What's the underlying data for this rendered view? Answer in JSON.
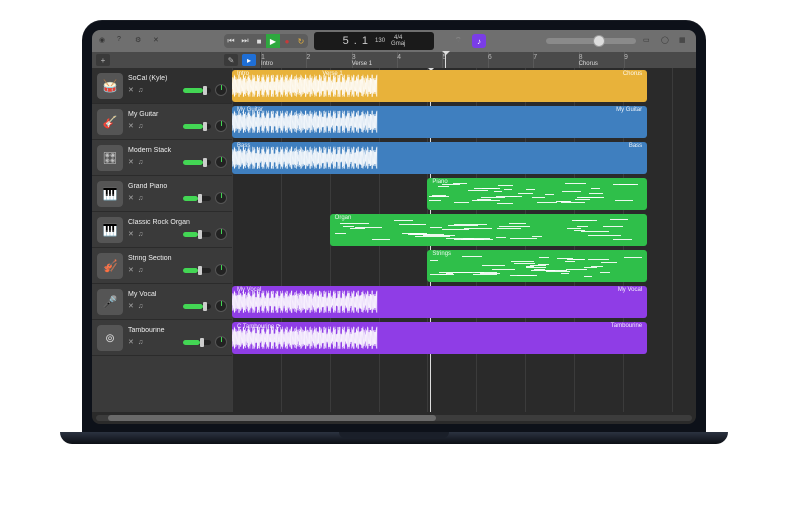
{
  "transport": {
    "position": "5 . 1",
    "tempo": "130",
    "time_sig": "4/4",
    "key": "Gmaj",
    "countin_icon": "countin-icon",
    "master_volume_pct": 58
  },
  "ruler": {
    "bars": [
      "1",
      "2",
      "3",
      "4",
      "5",
      "6",
      "7",
      "8",
      "9"
    ],
    "markers": [
      {
        "label": "Intro",
        "bar": 1
      },
      {
        "label": "Verse 1",
        "bar": 3
      },
      {
        "label": "Chorus",
        "bar": 8
      }
    ],
    "playhead_bar": 5.05,
    "visible_bars": 9.5
  },
  "tracks": [
    {
      "name": "SoCal (Kyle)",
      "type": "audio",
      "icon": "drums-icon",
      "color": "#e8b23a",
      "fader_pct": 70,
      "selected": true,
      "regions": [
        {
          "label_left": "Intro",
          "label_mid": "Verse 1",
          "label_right": "Chorus",
          "start": 1,
          "end": 9.5
        }
      ]
    },
    {
      "name": "My Guitar",
      "type": "audio",
      "icon": "guitar-icon",
      "color": "#3f7fbf",
      "fader_pct": 70,
      "regions": [
        {
          "label_left": "My Guitar",
          "label_right": "My Guitar",
          "start": 1,
          "end": 9.5
        }
      ]
    },
    {
      "name": "Modern Stack",
      "type": "audio",
      "icon": "synth-icon",
      "color": "#3f7fbf",
      "fader_pct": 70,
      "regions": [
        {
          "label_left": "Bass",
          "label_right": "Bass",
          "start": 1,
          "end": 9.5
        }
      ]
    },
    {
      "name": "Grand Piano",
      "type": "midi",
      "icon": "piano-icon",
      "color": "#2fbf4a",
      "fader_pct": 55,
      "regions": [
        {
          "label_left": "Piano",
          "start": 5,
          "end": 9.5
        }
      ]
    },
    {
      "name": "Classic Rock Organ",
      "type": "midi",
      "icon": "organ-icon",
      "color": "#2fbf4a",
      "fader_pct": 55,
      "regions": [
        {
          "label_left": "Organ",
          "start": 3,
          "end": 9.5
        }
      ]
    },
    {
      "name": "String Section",
      "type": "midi",
      "icon": "strings-icon",
      "color": "#2fbf4a",
      "fader_pct": 55,
      "regions": [
        {
          "label_left": "Strings",
          "start": 5,
          "end": 9.5
        }
      ]
    },
    {
      "name": "My Vocal",
      "type": "audio",
      "icon": "mic-icon",
      "color": "#8f3de6",
      "fader_pct": 70,
      "regions": [
        {
          "label_left": "My Vocal",
          "label_right": "My Vocal",
          "start": 1,
          "end": 9.5
        }
      ]
    },
    {
      "name": "Tambourine",
      "type": "audio",
      "icon": "tambourine-icon",
      "color": "#8f3de6",
      "fader_pct": 60,
      "regions": [
        {
          "label_left": "C Tambourine  ⟳",
          "label_right": "Tambourine",
          "start": 1,
          "end": 9.5
        }
      ]
    }
  ],
  "hscroll": {
    "thumb_left_pct": 2,
    "thumb_width_pct": 55
  }
}
